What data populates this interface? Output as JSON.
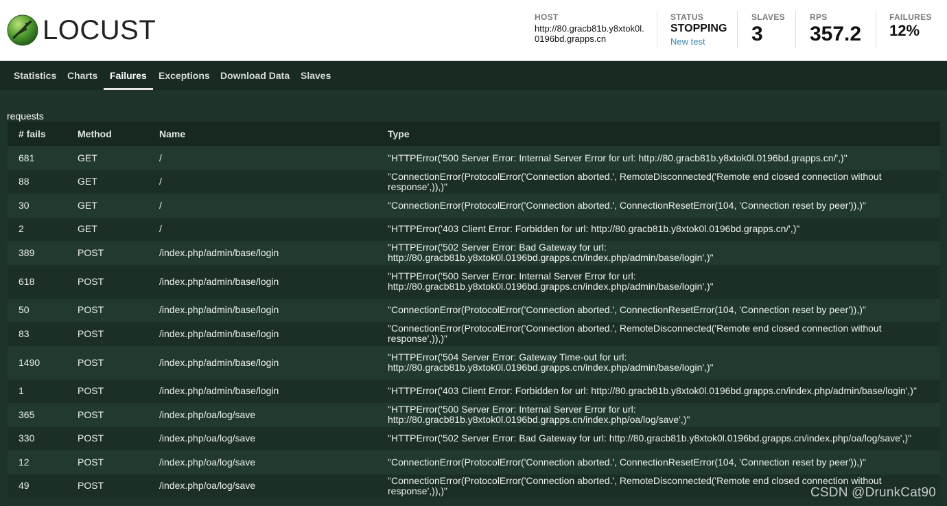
{
  "brand": {
    "name": "LOCUST",
    "logo_icon": "locust-logo-icon"
  },
  "header": {
    "host_label": "HOST",
    "host_value": "http://80.gracb81b.y8xtok0l.0196bd.grapps.cn",
    "status_label": "STATUS",
    "status_value": "STOPPING",
    "new_test_label": "New test",
    "slaves_label": "SLAVES",
    "slaves_value": "3",
    "rps_label": "RPS",
    "rps_value": "357.2",
    "failures_label": "FAILURES",
    "failures_value": "12%"
  },
  "nav": {
    "tabs": [
      {
        "label": "Statistics"
      },
      {
        "label": "Charts"
      },
      {
        "label": "Failures",
        "active": true
      },
      {
        "label": "Exceptions"
      },
      {
        "label": "Download Data"
      },
      {
        "label": "Slaves"
      }
    ]
  },
  "failures": {
    "section_label": "requests",
    "columns": [
      "# fails",
      "Method",
      "Name",
      "Type"
    ],
    "rows": [
      {
        "fails": "681",
        "method": "GET",
        "name": "/",
        "type": "\"HTTPError('500 Server Error: Internal Server Error for url: http://80.gracb81b.y8xtok0l.0196bd.grapps.cn/',)\""
      },
      {
        "fails": "88",
        "method": "GET",
        "name": "/",
        "type": "\"ConnectionError(ProtocolError('Connection aborted.', RemoteDisconnected('Remote end closed connection without response',)),)\""
      },
      {
        "fails": "30",
        "method": "GET",
        "name": "/",
        "type": "\"ConnectionError(ProtocolError('Connection aborted.', ConnectionResetError(104, 'Connection reset by peer')),)\""
      },
      {
        "fails": "2",
        "method": "GET",
        "name": "/",
        "type": "\"HTTPError('403 Client Error: Forbidden for url: http://80.gracb81b.y8xtok0l.0196bd.grapps.cn/',)\""
      },
      {
        "fails": "389",
        "method": "POST",
        "name": "/index.php/admin/base/login",
        "type": "\"HTTPError('502 Server Error: Bad Gateway for url: http://80.gracb81b.y8xtok0l.0196bd.grapps.cn/index.php/admin/base/login',)\""
      },
      {
        "fails": "618",
        "method": "POST",
        "name": "/index.php/admin/base/login",
        "type": "\"HTTPError('500 Server Error: Internal Server Error for url: http://80.gracb81b.y8xtok0l.0196bd.grapps.cn/index.php/admin/base/login',)\"",
        "tall": true
      },
      {
        "fails": "50",
        "method": "POST",
        "name": "/index.php/admin/base/login",
        "type": "\"ConnectionError(ProtocolError('Connection aborted.', ConnectionResetError(104, 'Connection reset by peer')),)\""
      },
      {
        "fails": "83",
        "method": "POST",
        "name": "/index.php/admin/base/login",
        "type": "\"ConnectionError(ProtocolError('Connection aborted.', RemoteDisconnected('Remote end closed connection without response',)),)\""
      },
      {
        "fails": "1490",
        "method": "POST",
        "name": "/index.php/admin/base/login",
        "type": "\"HTTPError('504 Server Error: Gateway Time-out for url: http://80.gracb81b.y8xtok0l.0196bd.grapps.cn/index.php/admin/base/login',)\"",
        "tall": true
      },
      {
        "fails": "1",
        "method": "POST",
        "name": "/index.php/admin/base/login",
        "type": "\"HTTPError('403 Client Error: Forbidden for url: http://80.gracb81b.y8xtok0l.0196bd.grapps.cn/index.php/admin/base/login',)\""
      },
      {
        "fails": "365",
        "method": "POST",
        "name": "/index.php/oa/log/save",
        "type": "\"HTTPError('500 Server Error: Internal Server Error for url: http://80.gracb81b.y8xtok0l.0196bd.grapps.cn/index.php/oa/log/save',)\""
      },
      {
        "fails": "330",
        "method": "POST",
        "name": "/index.php/oa/log/save",
        "type": "\"HTTPError('502 Server Error: Bad Gateway for url: http://80.gracb81b.y8xtok0l.0196bd.grapps.cn/index.php/oa/log/save',)\""
      },
      {
        "fails": "12",
        "method": "POST",
        "name": "/index.php/oa/log/save",
        "type": "\"ConnectionError(ProtocolError('Connection aborted.', ConnectionResetError(104, 'Connection reset by peer')),)\""
      },
      {
        "fails": "49",
        "method": "POST",
        "name": "/index.php/oa/log/save",
        "type": "\"ConnectionError(ProtocolError('Connection aborted.', RemoteDisconnected('Remote end closed connection without response',)),)\""
      }
    ]
  },
  "watermark": "CSDN @DrunkCat90",
  "colors": {
    "background": "#1f3429",
    "header_bg": "#ffffff",
    "link": "#3a87ad"
  }
}
